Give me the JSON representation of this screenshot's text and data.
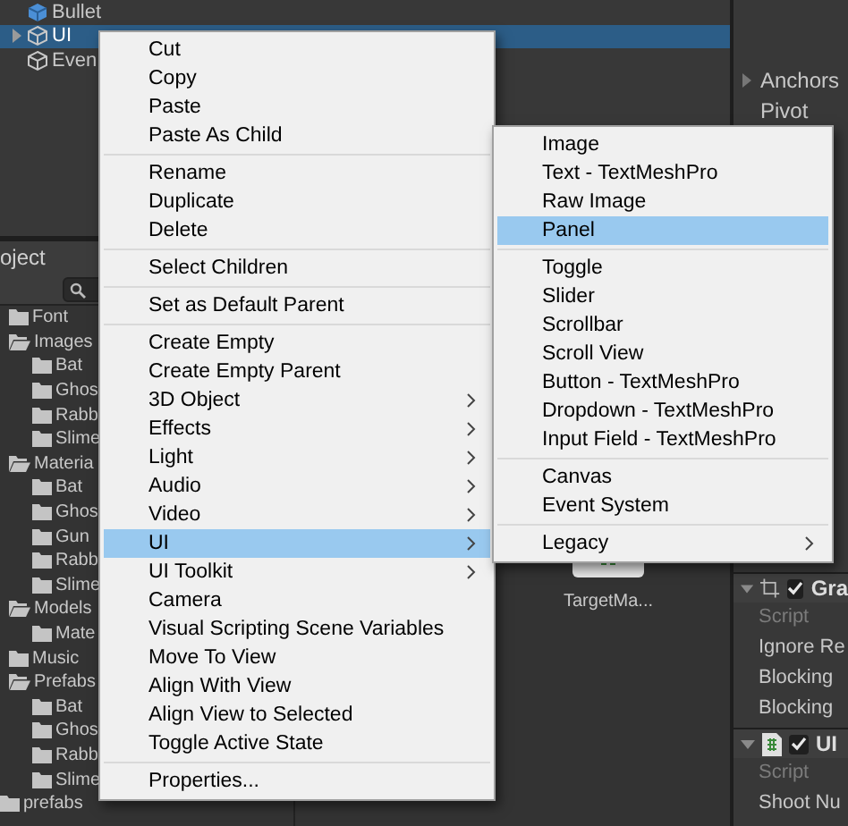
{
  "hierarchy": {
    "items": [
      {
        "label": "Bullet",
        "kind": "prefab",
        "selected": false,
        "has_children": false
      },
      {
        "label": "UI",
        "kind": "object",
        "selected": true,
        "has_children": true
      },
      {
        "label": "Even",
        "kind": "object",
        "selected": false,
        "has_children": false
      }
    ]
  },
  "project": {
    "tab": "oject",
    "tree": [
      {
        "label": "Font",
        "expanded": false
      },
      {
        "label": "Images",
        "expanded": true,
        "children": [
          {
            "label": "Bat",
            "expanded": false
          },
          {
            "label": "Ghos",
            "expanded": false
          },
          {
            "label": "Rabb",
            "expanded": false
          },
          {
            "label": "Slime",
            "expanded": false
          }
        ]
      },
      {
        "label": "Materia",
        "expanded": true,
        "children": [
          {
            "label": "Bat",
            "expanded": false
          },
          {
            "label": "Ghos",
            "expanded": false
          },
          {
            "label": "Gun",
            "expanded": false
          },
          {
            "label": "Rabb",
            "expanded": false
          },
          {
            "label": "Slime",
            "expanded": false
          }
        ]
      },
      {
        "label": "Models",
        "expanded": true,
        "children": [
          {
            "label": "Mate",
            "expanded": false
          }
        ]
      },
      {
        "label": "Music",
        "expanded": false
      },
      {
        "label": "Prefabs",
        "expanded": true,
        "children": [
          {
            "label": "Bat",
            "expanded": false
          },
          {
            "label": "Ghos",
            "expanded": false
          },
          {
            "label": "Rabb",
            "expanded": false
          },
          {
            "label": "Slime",
            "expanded": false
          }
        ]
      }
    ],
    "root_items": [
      {
        "label": "prefabs",
        "expanded": false
      }
    ],
    "assets": [
      {
        "label": "TargetMa..."
      }
    ]
  },
  "inspector": {
    "properties": [
      {
        "label": "Anchors",
        "foldout": true
      },
      {
        "label": "Pivot",
        "foldout": false
      }
    ],
    "components": [
      {
        "title": "Gra",
        "kind": "rect",
        "enabled": true,
        "fields": [
          {
            "label": "Script",
            "disabled": true
          },
          {
            "label": "Ignore Re",
            "disabled": false
          },
          {
            "label": "Blocking",
            "disabled": false
          },
          {
            "label": "Blocking",
            "disabled": false
          }
        ]
      },
      {
        "title": "UI",
        "kind": "script",
        "enabled": true,
        "fields": [
          {
            "label": "Script",
            "disabled": true
          },
          {
            "label": "Shoot Nu",
            "disabled": false
          }
        ]
      }
    ]
  },
  "context_menu": {
    "items": [
      {
        "kind": "item",
        "label": "Cut",
        "has_submenu": false,
        "selected": false
      },
      {
        "kind": "item",
        "label": "Copy",
        "has_submenu": false,
        "selected": false
      },
      {
        "kind": "item",
        "label": "Paste",
        "has_submenu": false,
        "selected": false
      },
      {
        "kind": "item",
        "label": "Paste As Child",
        "has_submenu": false,
        "selected": false
      },
      {
        "kind": "separator"
      },
      {
        "kind": "item",
        "label": "Rename",
        "has_submenu": false,
        "selected": false
      },
      {
        "kind": "item",
        "label": "Duplicate",
        "has_submenu": false,
        "selected": false
      },
      {
        "kind": "item",
        "label": "Delete",
        "has_submenu": false,
        "selected": false
      },
      {
        "kind": "separator"
      },
      {
        "kind": "item",
        "label": "Select Children",
        "has_submenu": false,
        "selected": false
      },
      {
        "kind": "separator"
      },
      {
        "kind": "item",
        "label": "Set as Default Parent",
        "has_submenu": false,
        "selected": false
      },
      {
        "kind": "separator"
      },
      {
        "kind": "item",
        "label": "Create Empty",
        "has_submenu": false,
        "selected": false
      },
      {
        "kind": "item",
        "label": "Create Empty Parent",
        "has_submenu": false,
        "selected": false
      },
      {
        "kind": "item",
        "label": "3D Object",
        "has_submenu": true,
        "selected": false
      },
      {
        "kind": "item",
        "label": "Effects",
        "has_submenu": true,
        "selected": false
      },
      {
        "kind": "item",
        "label": "Light",
        "has_submenu": true,
        "selected": false
      },
      {
        "kind": "item",
        "label": "Audio",
        "has_submenu": true,
        "selected": false
      },
      {
        "kind": "item",
        "label": "Video",
        "has_submenu": true,
        "selected": false
      },
      {
        "kind": "item",
        "label": "UI",
        "has_submenu": true,
        "selected": true
      },
      {
        "kind": "item",
        "label": "UI Toolkit",
        "has_submenu": true,
        "selected": false
      },
      {
        "kind": "item",
        "label": "Camera",
        "has_submenu": false,
        "selected": false
      },
      {
        "kind": "item",
        "label": "Visual Scripting Scene Variables",
        "has_submenu": false,
        "selected": false
      },
      {
        "kind": "item",
        "label": "Move To View",
        "has_submenu": false,
        "selected": false
      },
      {
        "kind": "item",
        "label": "Align With View",
        "has_submenu": false,
        "selected": false
      },
      {
        "kind": "item",
        "label": "Align View to Selected",
        "has_submenu": false,
        "selected": false
      },
      {
        "kind": "item",
        "label": "Toggle Active State",
        "has_submenu": false,
        "selected": false
      },
      {
        "kind": "separator"
      },
      {
        "kind": "item",
        "label": "Properties...",
        "has_submenu": false,
        "selected": false
      }
    ]
  },
  "submenu": {
    "items": [
      {
        "kind": "item",
        "label": "Image",
        "has_submenu": false,
        "selected": false
      },
      {
        "kind": "item",
        "label": "Text - TextMeshPro",
        "has_submenu": false,
        "selected": false
      },
      {
        "kind": "item",
        "label": "Raw Image",
        "has_submenu": false,
        "selected": false
      },
      {
        "kind": "item",
        "label": "Panel",
        "has_submenu": false,
        "selected": true
      },
      {
        "kind": "separator"
      },
      {
        "kind": "item",
        "label": "Toggle",
        "has_submenu": false,
        "selected": false
      },
      {
        "kind": "item",
        "label": "Slider",
        "has_submenu": false,
        "selected": false
      },
      {
        "kind": "item",
        "label": "Scrollbar",
        "has_submenu": false,
        "selected": false
      },
      {
        "kind": "item",
        "label": "Scroll View",
        "has_submenu": false,
        "selected": false
      },
      {
        "kind": "item",
        "label": "Button - TextMeshPro",
        "has_submenu": false,
        "selected": false
      },
      {
        "kind": "item",
        "label": "Dropdown - TextMeshPro",
        "has_submenu": false,
        "selected": false
      },
      {
        "kind": "item",
        "label": "Input Field - TextMeshPro",
        "has_submenu": false,
        "selected": false
      },
      {
        "kind": "separator"
      },
      {
        "kind": "item",
        "label": "Canvas",
        "has_submenu": false,
        "selected": false
      },
      {
        "kind": "item",
        "label": "Event System",
        "has_submenu": false,
        "selected": false
      },
      {
        "kind": "separator"
      },
      {
        "kind": "item",
        "label": "Legacy",
        "has_submenu": true,
        "selected": false
      }
    ]
  }
}
